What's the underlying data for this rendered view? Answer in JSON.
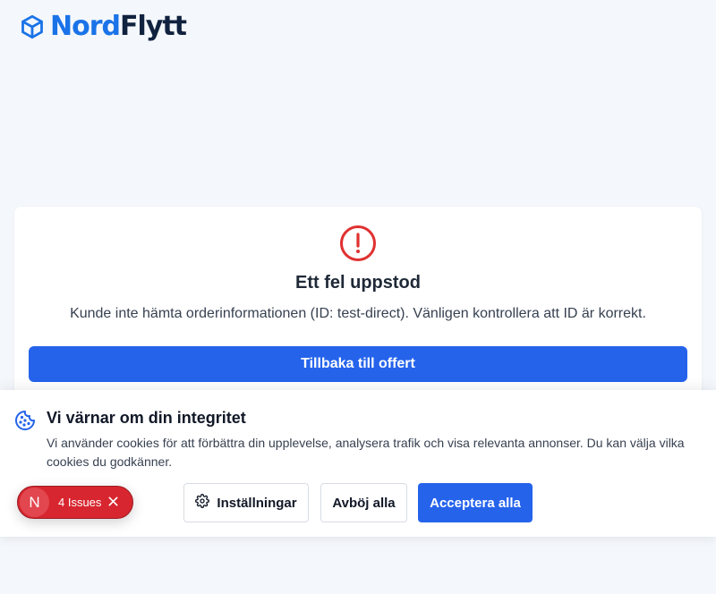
{
  "brand": {
    "name_part1": "Nord",
    "name_part2": "Flytt",
    "primary_color": "#1a73e8",
    "dark_color": "#10223f",
    "logo_icon": "box-icon"
  },
  "error_card": {
    "icon": "alert-circle-icon",
    "title": "Ett fel uppstod",
    "message": "Kunde inte hämta orderinformationen (ID: test-direct). Vänligen kontrollera att ID är korrekt.",
    "button_label": "Tillbaka till offert",
    "accent_color": "#2563eb",
    "error_color": "#e03131"
  },
  "cookie_banner": {
    "icon": "cookie-icon",
    "title": "Vi värnar om din integritet",
    "text": "Vi använder cookies för att förbättra din upplevelse, analysera trafik och visa relevanta annonser. Du kan välja vilka cookies du godkänner.",
    "settings_label": "Inställningar",
    "settings_icon": "gear-icon",
    "reject_label": "Avböj alla",
    "accept_label": "Acceptera alla"
  },
  "issues_indicator": {
    "badge_letter": "N",
    "label": "4 Issues",
    "close_icon": "close-icon",
    "color": "#d7262f"
  }
}
